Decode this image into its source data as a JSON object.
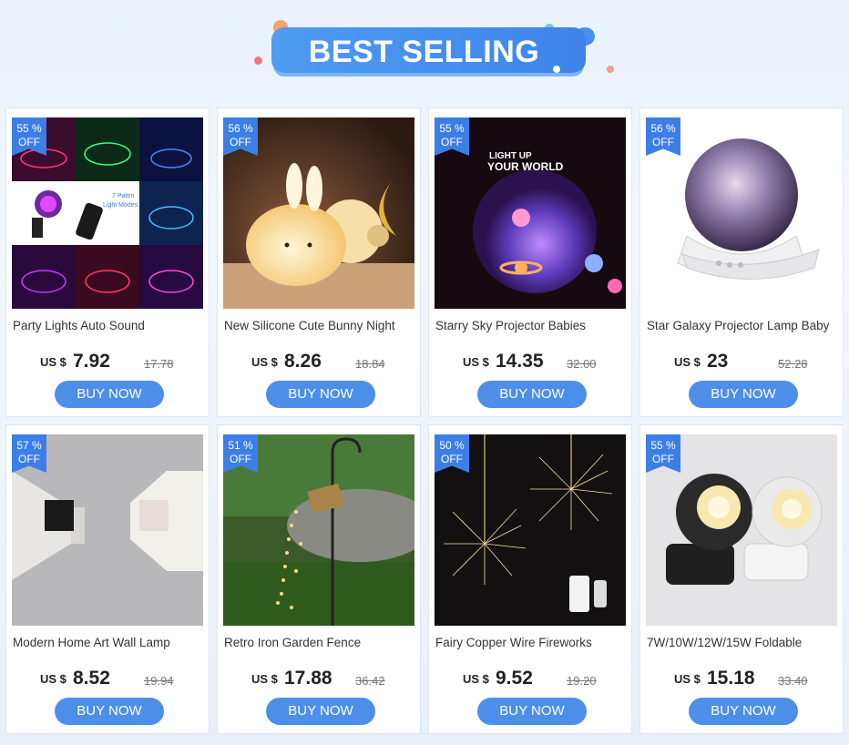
{
  "header": {
    "title": "BEST SELLING"
  },
  "currency_label": "US $",
  "buy_label": "BUY NOW",
  "products": [
    {
      "discount_pct": "55 %",
      "off": "OFF",
      "title": "Party Lights Auto Sound",
      "price": "7.92",
      "old_price": "17.78",
      "image": "disco-ball-party-light-collage"
    },
    {
      "discount_pct": "56 %",
      "off": "OFF",
      "title": "New Silicone Cute Bunny Night",
      "price": "8.26",
      "old_price": "18.84",
      "image": "bunny-night-light"
    },
    {
      "discount_pct": "55 %",
      "off": "OFF",
      "title": "Starry Sky Projector Babies",
      "price": "14.35",
      "old_price": "32.00",
      "image": "starry-sky-projector",
      "image_caption": "LIGHT UP YOUR WORLD"
    },
    {
      "discount_pct": "56 %",
      "off": "OFF",
      "title": "Star Galaxy Projector Lamp Baby",
      "price": "23",
      "old_price": "52.28",
      "image": "galaxy-projector-lamp"
    },
    {
      "discount_pct": "57 %",
      "off": "OFF",
      "title": "Modern Home Art Wall Lamp",
      "price": "8.52",
      "old_price": "19.94",
      "image": "wall-lamp"
    },
    {
      "discount_pct": "51 %",
      "off": "OFF",
      "title": "Retro Iron Garden Fence",
      "price": "17.88",
      "old_price": "36.42",
      "image": "watering-can-garden-light"
    },
    {
      "discount_pct": "50 %",
      "off": "OFF",
      "title": "Fairy Copper Wire Fireworks",
      "price": "9.52",
      "old_price": "19.20",
      "image": "firework-fairy-lights"
    },
    {
      "discount_pct": "55 %",
      "off": "OFF",
      "title": "7W/10W/12W/15W Foldable",
      "price": "15.18",
      "old_price": "33.40",
      "image": "spotlight-lamps"
    }
  ],
  "colors": {
    "accent": "#4d8fe8",
    "badge": "#3d7ee6",
    "banner": "#4f9cf2"
  }
}
